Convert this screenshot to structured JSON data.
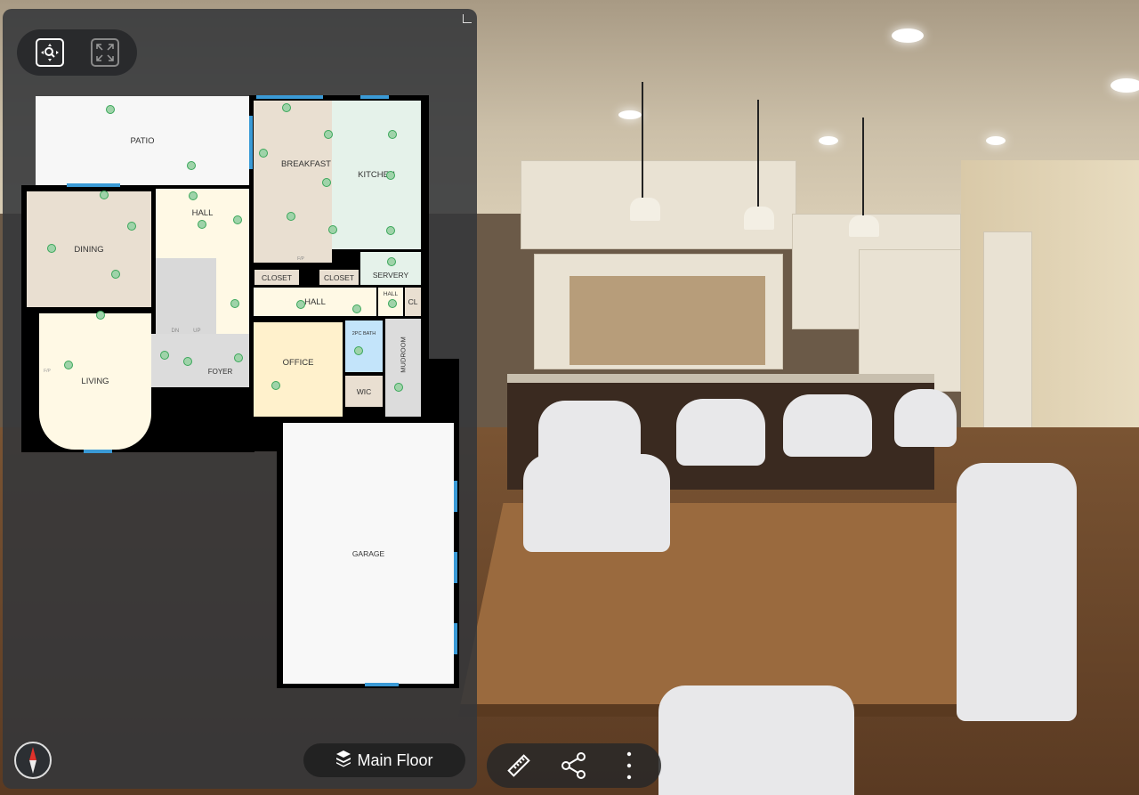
{
  "toolbar": {
    "navigate_icon": "zoom-pan-icon",
    "fullscreen_icon": "expand-icon"
  },
  "floorplan": {
    "rooms": {
      "patio": "PATIO",
      "breakfast": "BREAKFAST",
      "kitchen": "KITCHEN",
      "dining": "DINING",
      "hall_upper": "HALL",
      "living": "LIVING",
      "foyer": "FOYER",
      "office": "OFFICE",
      "closet1": "CLOSET",
      "closet2": "CLOSET",
      "servery": "SERVERY",
      "hall_middle": "HALL",
      "hall_small": "HALL",
      "cl": "CL",
      "bath": "2PC BATH",
      "wic": "WIC",
      "mudroom": "MUDROOM",
      "garage": "GARAGE",
      "fp_living": "F/P",
      "fp_breakfast": "F/P",
      "stairs_down": "DN",
      "stairs_up": "UP"
    },
    "colors": {
      "scan_point": "#3aa75a",
      "window": "#3a9ad6"
    }
  },
  "floor_selector": {
    "label": "Main Floor",
    "icon": "layers-icon"
  },
  "bottom_bar": {
    "measure_icon": "ruler-icon",
    "share_icon": "share-icon",
    "more_icon": "more-vertical-icon"
  }
}
